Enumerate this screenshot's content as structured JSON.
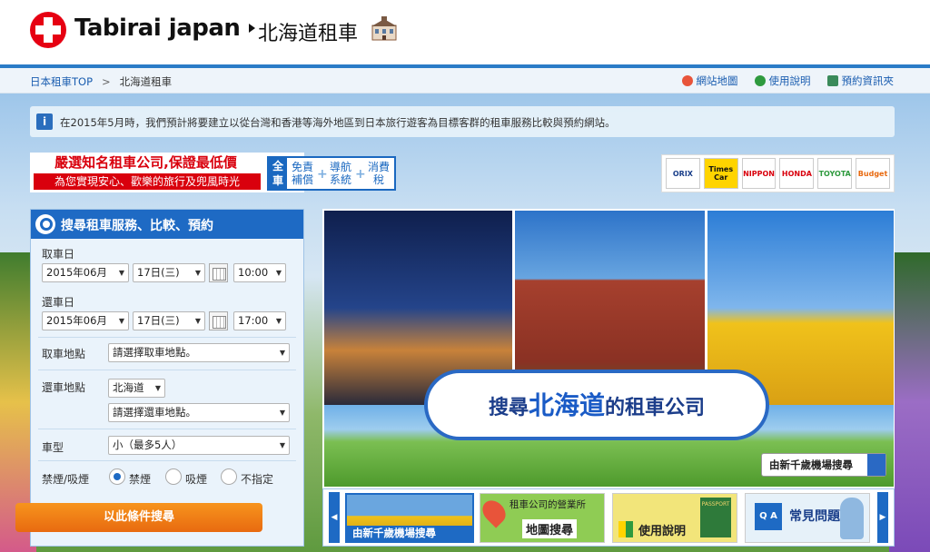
{
  "header": {
    "logo_text": "Tabirai japan",
    "logo_sub": "北海道租車",
    "building_icon": "building-icon"
  },
  "breadcrumb": {
    "top": "日本租車TOP",
    "sep": ">",
    "current": "北海道租車"
  },
  "toplinks": [
    {
      "label": "網站地圖",
      "icon": "map-pin-icon",
      "color": "#e8543a"
    },
    {
      "label": "使用說明",
      "icon": "beginner-icon",
      "color": "#2e9a3e"
    },
    {
      "label": "預約資訊夾",
      "icon": "document-icon",
      "color": "#3a8a5a"
    }
  ],
  "info": {
    "icon": "i",
    "text": "在2015年5月時，我們預計將要建立以從台灣和香港等海外地區到日本旅行遊客為目標客群的租車服務比較與預約網站。"
  },
  "banner": {
    "line1": "嚴選知名租車公司,保證最低價",
    "line2": "為您實現安心、歡樂的旅行及兜風時光"
  },
  "features": {
    "all": "全車",
    "items": [
      "免責補償",
      "導航系統",
      "消費稅"
    ]
  },
  "brands": [
    {
      "label": "ORIX",
      "bg": "#ffffff",
      "fg": "#1a3f8a"
    },
    {
      "label": "Times Car",
      "bg": "#ffd400",
      "fg": "#111111"
    },
    {
      "label": "NIPPON",
      "bg": "#ffffff",
      "fg": "#d9000d"
    },
    {
      "label": "HONDA",
      "bg": "#ffffff",
      "fg": "#d9000d"
    },
    {
      "label": "TOYOTA",
      "bg": "#ffffff",
      "fg": "#2e9a3e"
    },
    {
      "label": "Budget",
      "bg": "#ffffff",
      "fg": "#e86a10"
    }
  ],
  "search": {
    "title": "搜尋租車服務、比較、預約",
    "pickup_label": "取車日",
    "pickup_month": "2015年06月",
    "pickup_day": "17日(三)",
    "pickup_time": "10:00",
    "return_label": "還車日",
    "return_month": "2015年06月",
    "return_day": "17日(三)",
    "return_time": "17:00",
    "pickup_place_label": "取車地點",
    "pickup_place": "請選擇取車地點。",
    "return_place_label": "還車地點",
    "return_region": "北海道",
    "return_place": "請選擇還車地點。",
    "car_label": "車型",
    "car": "小（最多5人）",
    "smoke_label": "禁煙/吸煙",
    "smoke_options": [
      "禁煙",
      "吸煙",
      "不指定"
    ],
    "button": "以此條件搜尋"
  },
  "hero": {
    "bubble_pre": "搜尋",
    "bubble_main": "北海道",
    "bubble_post": "的租車公司",
    "cts_button": "由新千歲機場搜尋"
  },
  "carousel": {
    "prev": "◀",
    "next": "▶",
    "tiles": [
      {
        "label": "由新千歲機場搜尋"
      },
      {
        "label_small": "租車公司的營業所",
        "label": "地圖搜尋"
      },
      {
        "label": "使用說明",
        "badge": "PASSPORT"
      },
      {
        "label": "常見問題",
        "badge": "Q A"
      }
    ]
  }
}
